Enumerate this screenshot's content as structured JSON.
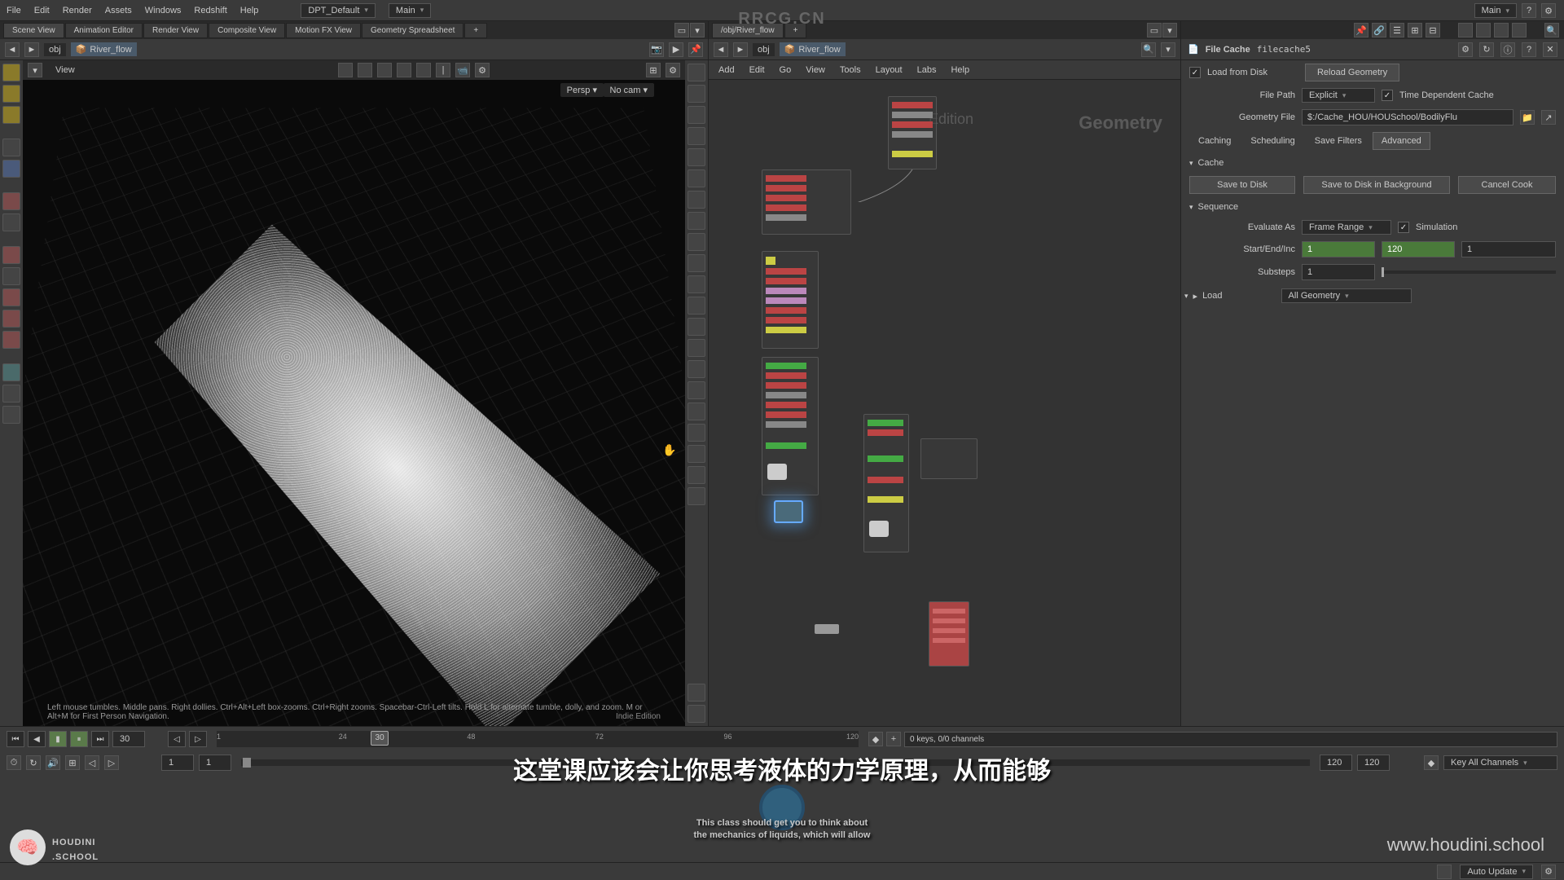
{
  "watermark": "RRCG.CN",
  "menu": {
    "file": "File",
    "edit": "Edit",
    "render": "Render",
    "assets": "Assets",
    "windows": "Windows",
    "redshift": "Redshift",
    "help": "Help"
  },
  "desktop": "DPT_Default",
  "scene_combo": "Main",
  "top_right_scene": "Main",
  "tabs_left": {
    "scene": "Scene View",
    "anim": "Animation Editor",
    "render": "Render View",
    "comp": "Composite View",
    "mfx": "Motion FX View",
    "geo": "Geometry Spreadsheet"
  },
  "path_left": {
    "root": "obj",
    "node": "River_flow"
  },
  "view_label": "View",
  "persp": "Persp ▾",
  "nocam": "No cam ▾",
  "hint": "Left mouse tumbles. Middle pans. Right dollies. Ctrl+Alt+Left box-zooms. Ctrl+Right zooms. Spacebar-Ctrl-Left tilts. Hold L for alternate tumble, dolly, and zoom. M or Alt+M for First Person Navigation.",
  "indie": "Indie Edition",
  "node_tabs": {
    "path": "/obj/River_flow"
  },
  "node_path": {
    "root": "obj",
    "node": "River_flow"
  },
  "node_menu": {
    "add": "Add",
    "edit": "Edit",
    "go": "Go",
    "view": "View",
    "tools": "Tools",
    "layout": "Layout",
    "labs": "Labs",
    "help": "Help"
  },
  "geom_label": "Geometry",
  "indie_label": "Edition",
  "params": {
    "type": "File Cache",
    "name": "filecache5",
    "load_chk": "Load from Disk",
    "reload": "Reload Geometry",
    "filepath_lbl": "File Path",
    "filepath_mode": "Explicit",
    "timedep": "Time Dependent Cache",
    "geofile_lbl": "Geometry File",
    "geofile": "$:/Cache_HOU/HOUSchool/BodilyFlu",
    "tabs": {
      "caching": "Caching",
      "scheduling": "Scheduling",
      "savefilters": "Save Filters",
      "advanced": "Advanced"
    },
    "cache": "Cache",
    "save": "Save to Disk",
    "savebg": "Save to Disk in Background",
    "cancel": "Cancel Cook",
    "sequence": "Sequence",
    "evalas_lbl": "Evaluate As",
    "evalas": "Frame Range",
    "sim": "Simulation",
    "sei_lbl": "Start/End/Inc",
    "start": "1",
    "end": "120",
    "inc": "1",
    "substeps_lbl": "Substeps",
    "substeps": "1",
    "load": "Load",
    "allgeo": "All Geometry"
  },
  "timeline": {
    "cur": "30",
    "marks": [
      "1",
      "24",
      "48",
      "72",
      "96",
      "120"
    ],
    "start": "1",
    "rstart": "1",
    "end": "120",
    "rend": "120",
    "keys": "0 keys, 0/0 channels",
    "keyall": "Key All Channels",
    "auto": "Auto Update"
  },
  "subtitle_zh": "这堂课应该会让你思考液体的力学原理，从而能够",
  "subtitle_en1": "This class should get you to think about",
  "subtitle_en2": "the mechanics of liquids, which will allow",
  "logo_hs1": "HOUDINI",
  "logo_hs2": ".SCHOOL",
  "url": "www.houdini.school"
}
